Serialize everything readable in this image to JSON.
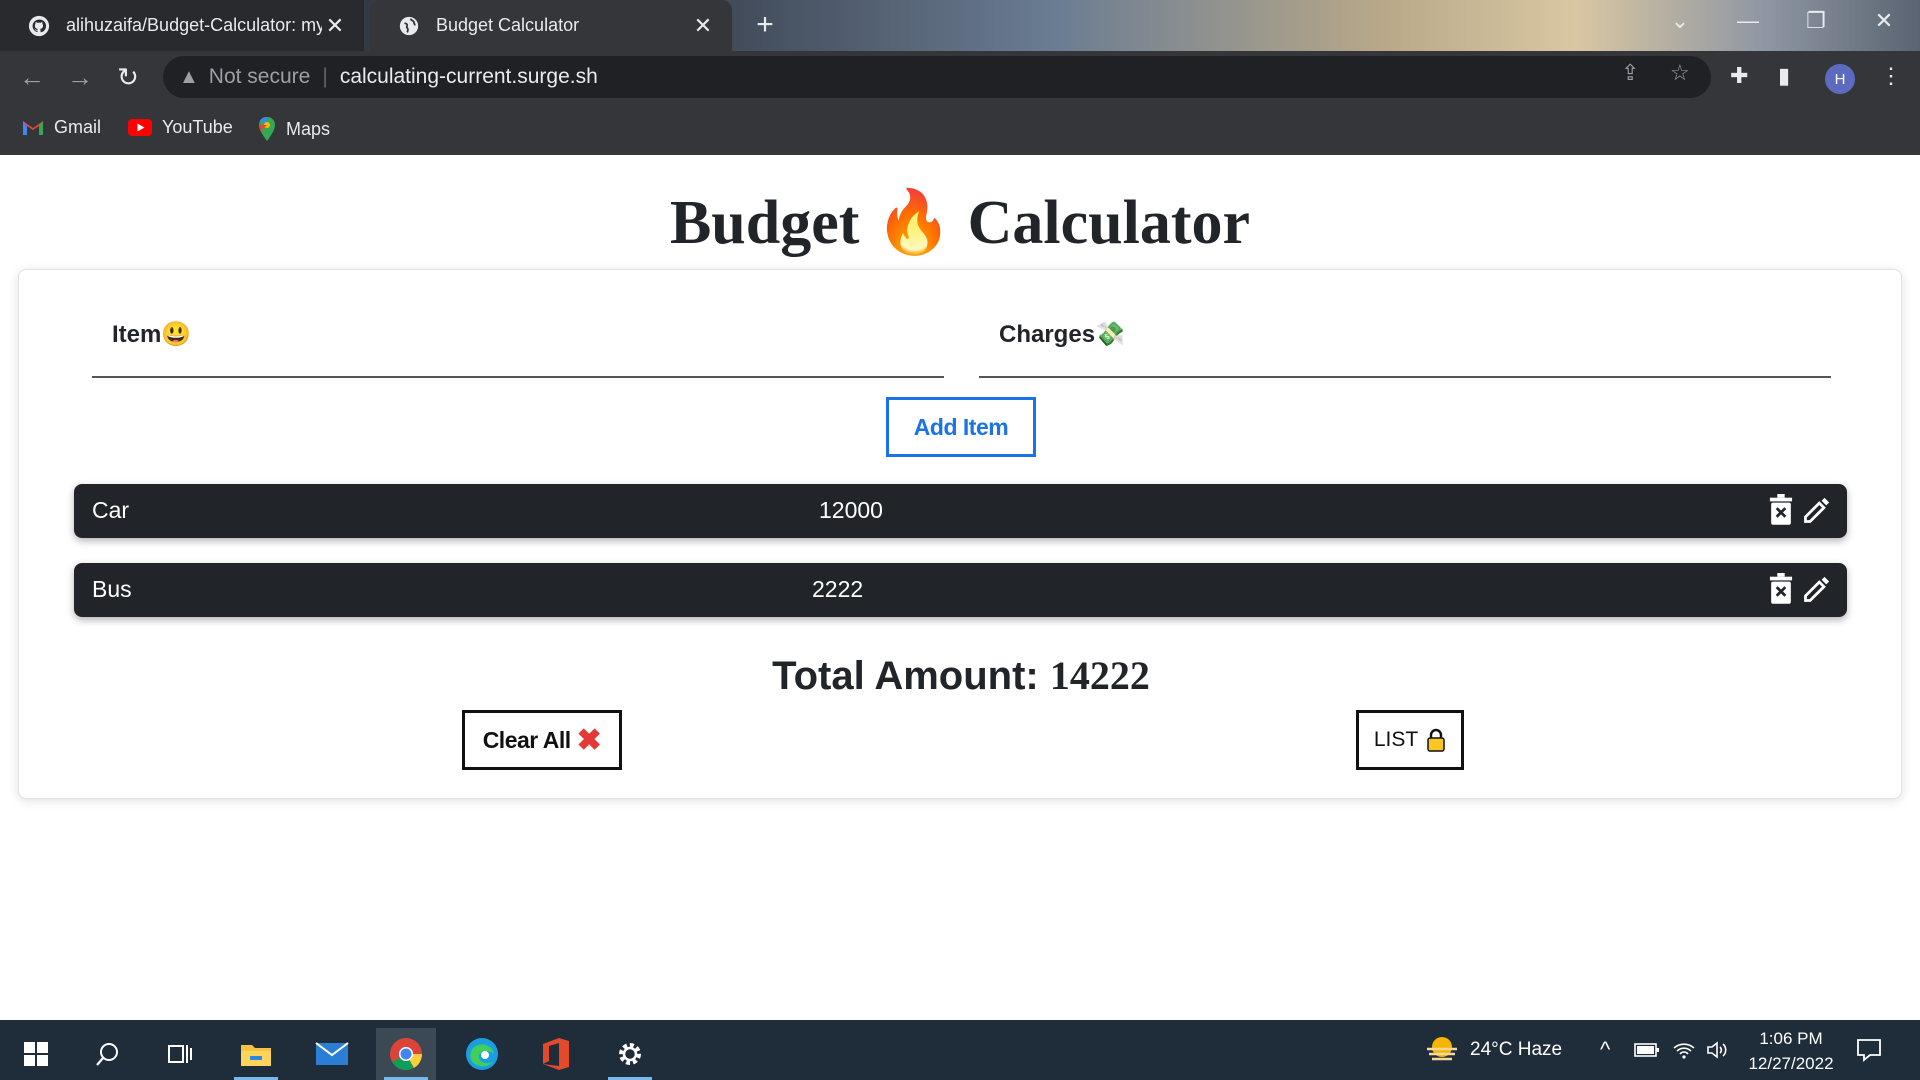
{
  "browser": {
    "tabs": [
      {
        "title": "alihuzaifa/Budget-Calculator: my"
      },
      {
        "title": "Budget Calculator"
      }
    ],
    "security_label": "Not secure",
    "url": "calculating-current.surge.sh",
    "profile_initial": "H",
    "bookmarks": [
      {
        "label": "Gmail"
      },
      {
        "label": "YouTube"
      },
      {
        "label": "Maps"
      }
    ]
  },
  "app": {
    "title_left": "Budget",
    "title_emoji": "🔥",
    "title_right": "Calculator",
    "item_label": "Item😃",
    "charges_label": "Charges💸",
    "add_button": "Add Item",
    "expenses": [
      {
        "name": "Car",
        "amount": "12000"
      },
      {
        "name": "Bus",
        "amount": "2222"
      }
    ],
    "total_label": "Total Amount:",
    "total_value": "14222",
    "clear_button": "Clear All",
    "list_button": "LIST"
  },
  "taskbar": {
    "weather": "24°C  Haze",
    "time": "1:06 PM",
    "date": "12/27/2022"
  },
  "colors": {
    "accent_blue": "#1a73e8",
    "row_dark": "#212529",
    "clear_red": "#e53935"
  }
}
